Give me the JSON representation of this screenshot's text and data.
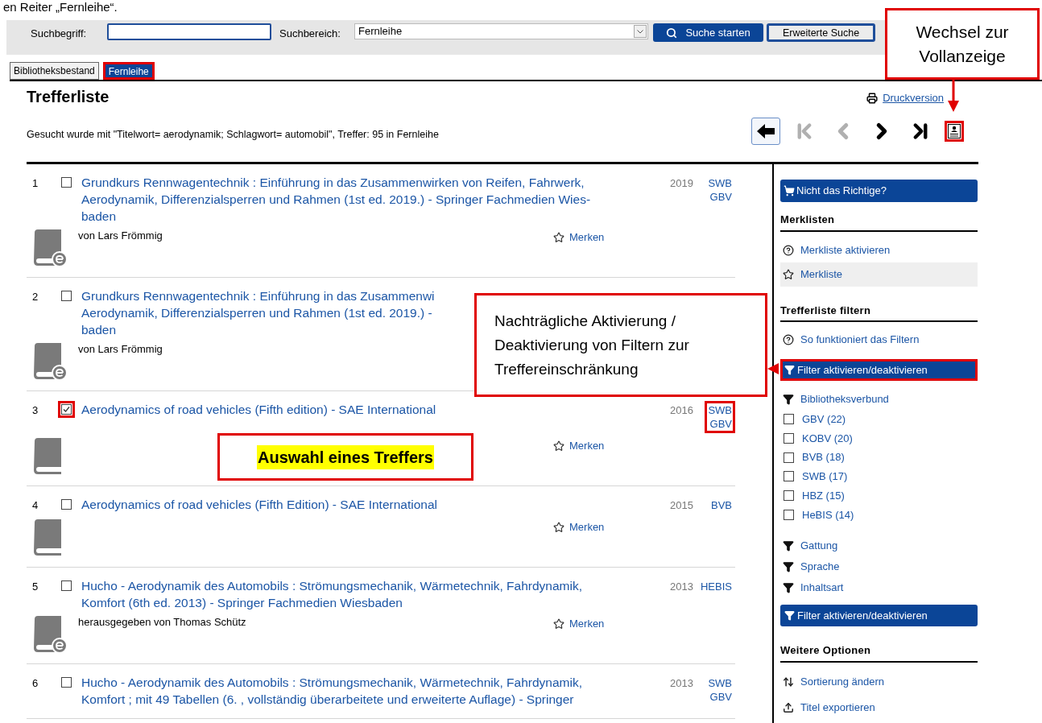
{
  "caption": "en Reiter „Fernleihe“.",
  "search": {
    "term_label": "Suchbegriff:",
    "scope_label": "Suchbereich:",
    "scope_value": "Fernleihe",
    "start_button": "Suche starten",
    "advanced_button": "Erweiterte Suche"
  },
  "tabs": [
    {
      "label": "Bibliotheksbestand",
      "selected": false,
      "highlighted": false
    },
    {
      "label": "Fernleihe",
      "selected": true,
      "highlighted": true
    }
  ],
  "heading": "Trefferliste",
  "print_link": "Druckversion",
  "query_info": "Gesucht wurde mit \"Titelwort= aerodynamik; Schlagwort= automobil\", Treffer: 95 in Fernleihe",
  "nav": [
    {
      "kind": "back",
      "disabled": false,
      "highlighted": false
    },
    {
      "kind": "first",
      "disabled": true,
      "highlighted": false
    },
    {
      "kind": "prev",
      "disabled": true,
      "highlighted": false
    },
    {
      "kind": "next",
      "disabled": false,
      "highlighted": false
    },
    {
      "kind": "last",
      "disabled": false,
      "highlighted": false
    },
    {
      "kind": "full_view",
      "disabled": false,
      "highlighted": true
    }
  ],
  "results": [
    {
      "number": "1",
      "checked": false,
      "checkbox_highlighted": false,
      "title_lines": [
        "Grundkurs Rennwagentechnik : Einführung in das Zusammenwirken von Reifen, Fahrwerk,",
        "Aerodynamik, Differenzialsperren und Rahmen (1st ed. 2019.) - Springer Fachmedien Wies-",
        "baden"
      ],
      "year": "2019",
      "sources": [
        "SWB",
        "GBV"
      ],
      "sources_highlighted": false,
      "kind": "ebook",
      "author": "von Lars Frömmig",
      "remember": "Merken"
    },
    {
      "number": "2",
      "checked": false,
      "checkbox_highlighted": false,
      "title_lines": [
        "Grundkurs Rennwagentechnik : Einführung in das Zusammenwi",
        "Aerodynamik, Differenzialsperren und Rahmen (1st ed. 2019.) -",
        "baden"
      ],
      "kind": "ebook",
      "author": "von Lars Frömmig"
    },
    {
      "number": "3",
      "checked": true,
      "checkbox_highlighted": true,
      "title_lines": [
        "Aerodynamics of road vehicles (Fifth edition) - SAE International"
      ],
      "year": "2016",
      "sources": [
        "SWB",
        "GBV"
      ],
      "sources_highlighted": true,
      "kind": "book",
      "remember": "Merken"
    },
    {
      "number": "4",
      "checked": false,
      "checkbox_highlighted": false,
      "title_lines": [
        "Aerodynamics of road vehicles (Fifth Edition) - SAE International"
      ],
      "year": "2015",
      "sources": [
        "BVB"
      ],
      "sources_highlighted": false,
      "kind": "book",
      "remember": "Merken"
    },
    {
      "number": "5",
      "checked": false,
      "checkbox_highlighted": false,
      "title_lines": [
        "Hucho - Aerodynamik des Automobils : Strömungsmechanik, Wärmetechnik, Fahrdynamik,",
        "Komfort (6th ed. 2013) - Springer Fachmedien Wiesbaden"
      ],
      "year": "2013",
      "sources": [
        "HEBIS"
      ],
      "sources_highlighted": false,
      "kind": "ebook",
      "author": "herausgegeben von Thomas Schütz",
      "remember": "Merken"
    },
    {
      "number": "6",
      "checked": false,
      "checkbox_highlighted": false,
      "title_lines": [
        "Hucho - Aerodynamik des Automobils : Strömungsmechanik, Wärmetechnik, Fahrdynamik,",
        "Komfort ; mit 49 Tabellen (6. , vollständig überarbeitete und erweiterte Auflage) - Springer"
      ],
      "year": "2013",
      "sources": [
        "SWB",
        "GBV"
      ],
      "sources_highlighted": false
    }
  ],
  "sidebar": {
    "top_button": "Nicht das Richtige?",
    "merklisten": {
      "heading": "Merklisten",
      "items": [
        {
          "kind": "help",
          "label": "Merkliste aktivieren",
          "selected": false
        },
        {
          "kind": "star",
          "label": "Merkliste",
          "selected": true
        }
      ]
    },
    "filters": {
      "heading": "Trefferliste filtern",
      "items": [
        {
          "kind": "help",
          "label": "So funktioniert das Filtern"
        },
        {
          "kind": "toggle",
          "label": "Filter aktivieren/deaktivieren",
          "highlighted": true
        },
        {
          "kind": "facet",
          "label": "Bibliotheksverbund",
          "options": [
            {
              "label": "GBV (22)",
              "checked": false
            },
            {
              "label": "KOBV (20)",
              "checked": false
            },
            {
              "label": "BVB (18)",
              "checked": false
            },
            {
              "label": "SWB (17)",
              "checked": false
            },
            {
              "label": "HBZ (15)",
              "checked": false
            },
            {
              "label": "HeBIS (14)",
              "checked": false
            }
          ]
        },
        {
          "kind": "facet",
          "label": "Gattung"
        },
        {
          "kind": "facet",
          "label": "Sprache"
        },
        {
          "kind": "facet",
          "label": "Inhaltsart"
        },
        {
          "kind": "toggle",
          "label": "Filter aktivieren/deaktivieren",
          "highlighted": false
        }
      ]
    },
    "more": {
      "heading": "Weitere Optionen",
      "items": [
        {
          "kind": "sort",
          "label": "Sortierung ändern"
        },
        {
          "kind": "export",
          "label": "Titel exportieren"
        }
      ]
    }
  },
  "annotations": {
    "full_view": "Wechsel zur Vollanzeige",
    "filter_toggle": "Nachträgliche Aktivierung / Deaktivierung von Filtern zur Treffereinschränkung",
    "selection": "Auswahl eines Treffers"
  }
}
